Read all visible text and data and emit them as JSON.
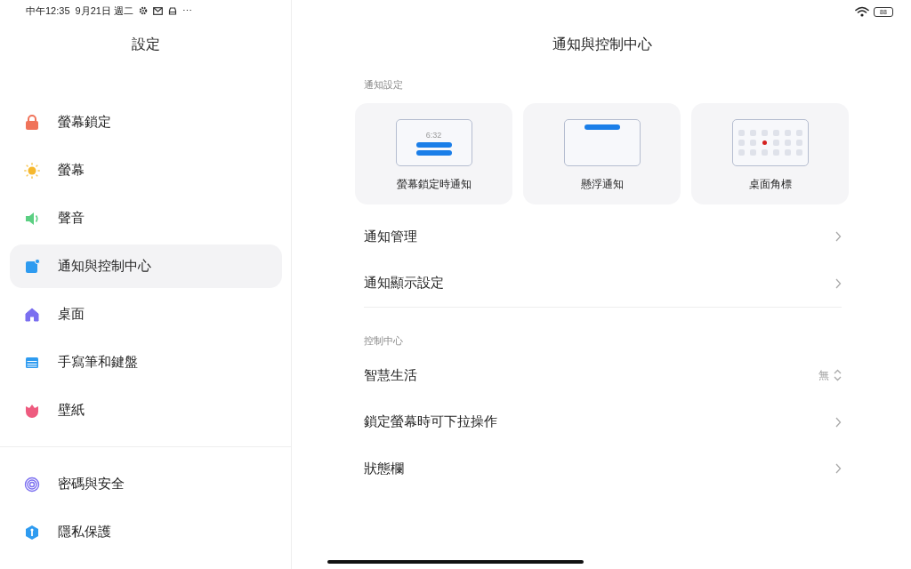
{
  "status_bar": {
    "time": "中午12:35",
    "date": "9月21日 週二",
    "more": "⋯",
    "battery": "88"
  },
  "sidebar": {
    "title": "設定",
    "groups": [
      [
        {
          "label": "螢幕鎖定",
          "selected": false
        },
        {
          "label": "螢幕",
          "selected": false
        },
        {
          "label": "聲音",
          "selected": false
        },
        {
          "label": "通知與控制中心",
          "selected": true
        },
        {
          "label": "桌面",
          "selected": false
        },
        {
          "label": "手寫筆和鍵盤",
          "selected": false
        },
        {
          "label": "壁紙",
          "selected": false
        }
      ],
      [
        {
          "label": "密碼與安全",
          "selected": false
        },
        {
          "label": "隱私保護",
          "selected": false
        }
      ]
    ]
  },
  "main": {
    "title": "通知與控制中心",
    "sections": [
      {
        "heading": "通知設定",
        "cards": [
          {
            "kind": "lockscreen",
            "label": "螢幕鎖定時通知",
            "time": "6:32"
          },
          {
            "kind": "floating",
            "label": "懸浮通知"
          },
          {
            "kind": "badge",
            "label": "桌面角標"
          }
        ],
        "rows": [
          {
            "kind": "link",
            "label": "通知管理"
          },
          {
            "kind": "link",
            "label": "通知顯示設定"
          }
        ]
      },
      {
        "heading": "控制中心",
        "rows": [
          {
            "kind": "select",
            "label": "智慧生活",
            "value": "無"
          },
          {
            "kind": "link",
            "label": "鎖定螢幕時可下拉操作"
          },
          {
            "kind": "link",
            "label": "狀態欄"
          }
        ]
      }
    ]
  }
}
